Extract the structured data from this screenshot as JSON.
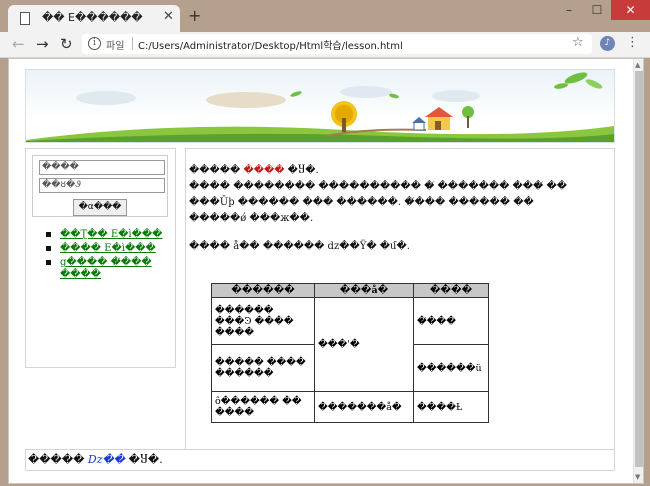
{
  "tab": {
    "title": "�� Ε������"
  },
  "toolbar": {
    "scheme_label": "파일",
    "url": "C:/Users/Administrator/Desktop/Html학습/lesson.html"
  },
  "icons": {
    "back": "back-arrow-icon",
    "forward": "forward-arrow-icon",
    "reload": "reload-icon",
    "star": "star-icon",
    "menu": "kebab-menu-icon"
  },
  "colors": {
    "link": "#0a7a0a",
    "highlight": "#c01818",
    "footer_italic": "#1a3ad0",
    "table_header": "#c7c7c7"
  },
  "login": {
    "id_value": "����",
    "pw_value": "��ȣ�Ꮽ",
    "button_label": "�α���"
  },
  "sidebar_menu": [
    "��Ʈ�� Ε�ì���",
    "���� Ε�ì���",
    "g����  �̸���  ����"
  ],
  "content": {
    "line1_a": "�����",
    "line1_red": "����",
    "line1_b": "�Ⴘ�.",
    "line2": "���� �������� ���������� �̸ ������� ���̸ ��",
    "line3": "���Ūþ ������ ��� ������. �̸��� ������ ��",
    "line4": "�����ǿ ���ж��.",
    "line5": "���� å�� ������ dz��Ÿ� �մ�."
  },
  "table": {
    "headers": [
      "������",
      "���å�",
      "����"
    ],
    "rows": [
      [
        "������ ���Ͽ ���� ����",
        "���'�",
        "�̸���"
      ],
      [
        "����� ���� ������",
        "",
        "������ü"
      ],
      [
        "ô������ �� ����",
        "�������å�",
        "����Ƚ"
      ]
    ]
  },
  "footer": {
    "text_a": "�����",
    "text_italic": "Dz��",
    "text_b": "�Ⴘ�."
  }
}
